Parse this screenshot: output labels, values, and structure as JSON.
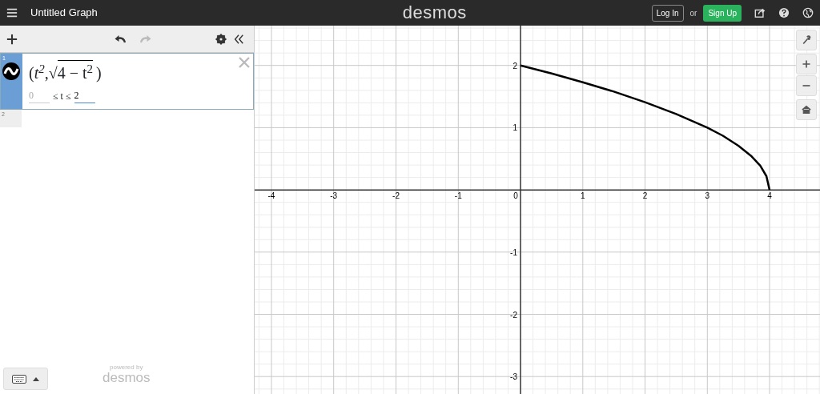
{
  "header": {
    "title": "Untitled Graph",
    "logo": "desmos",
    "login": "Log In",
    "or": "or",
    "signup": "Sign Up"
  },
  "expressions": [
    {
      "number": "1",
      "selected": true,
      "open": "(",
      "first": "t$^{2}$",
      "sep": ",",
      "radical": "√",
      "radicand": "4 − t$^{2}$",
      "close": ")",
      "domain": {
        "lower": "0",
        "relation": "≤ t ≤",
        "upper": "2"
      }
    },
    {
      "number": "2",
      "selected": false
    }
  ],
  "footer": {
    "powered": "powered by",
    "brand": "desmos"
  },
  "graph": {
    "chart_data": {
      "type": "line",
      "xlim": [
        -4.27,
        4.81
      ],
      "ylim": [
        -3.28,
        2.64
      ],
      "xticks": [
        -4,
        -3,
        -2,
        -1,
        0,
        1,
        2,
        3,
        4
      ],
      "yticks": [
        -3,
        -2,
        -1,
        1,
        2
      ],
      "x": [
        0,
        0.5,
        1,
        1.5,
        2,
        2.5,
        3,
        3.25,
        3.5,
        3.7,
        3.85,
        3.95,
        4
      ],
      "grid": true,
      "series": [
        {
          "color": "#000000",
          "values": [
            2,
            1.87,
            1.73,
            1.58,
            1.41,
            1.22,
            1,
            0.87,
            0.71,
            0.55,
            0.39,
            0.22,
            0
          ]
        }
      ]
    }
  }
}
